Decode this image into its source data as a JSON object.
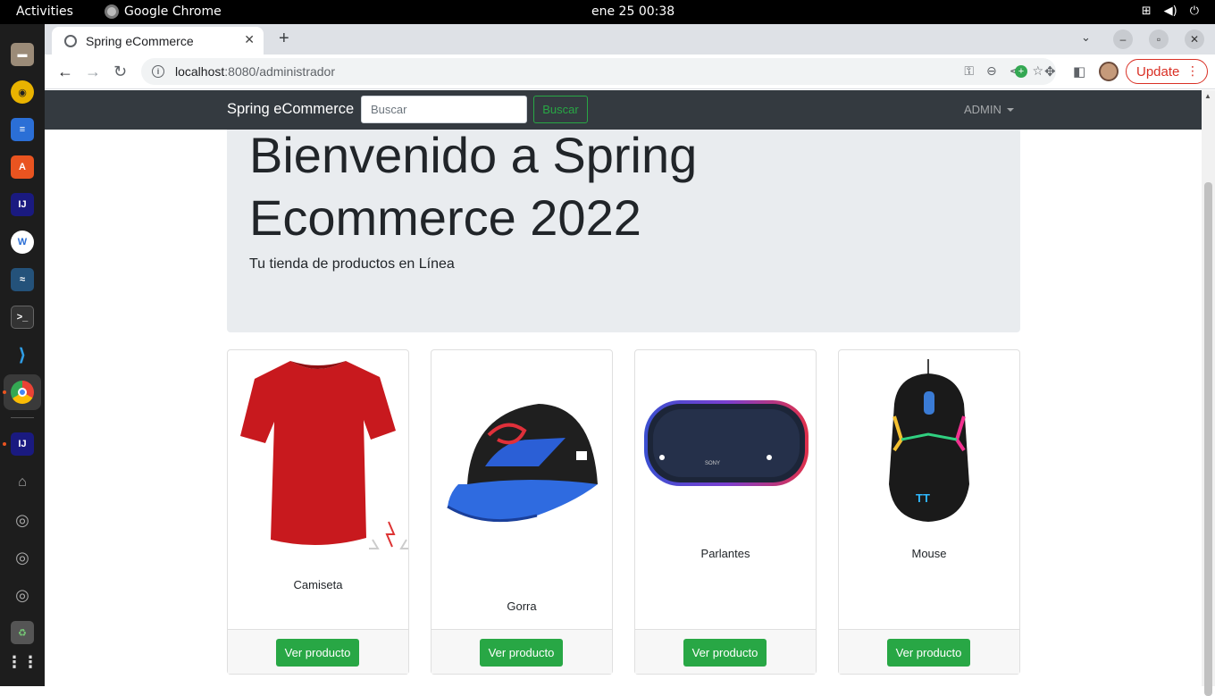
{
  "system": {
    "activities": "Activities",
    "app_name": "Google Chrome",
    "clock": "ene 25  00:38"
  },
  "browser": {
    "tab_title": "Spring eCommerce",
    "url_host": "localhost",
    "url_path": ":8080/administrador",
    "update_label": "Update"
  },
  "site": {
    "brand": "Spring eCommerce",
    "search_placeholder": "Buscar",
    "search_button": "Buscar",
    "admin_menu": "ADMIN",
    "accent_color": "#28a745",
    "navbar_color": "#343a40"
  },
  "hero": {
    "title": "Bienvenido a Spring Ecommerce 2022",
    "subtitle": "Tu tienda de productos en Línea"
  },
  "products": [
    {
      "name": "Camiseta",
      "image": "red-tshirt",
      "button": "Ver producto"
    },
    {
      "name": "Gorra",
      "image": "baseball-cap",
      "button": "Ver producto"
    },
    {
      "name": "Parlantes",
      "image": "bluetooth-speaker",
      "button": "Ver producto"
    },
    {
      "name": "Mouse",
      "image": "gaming-mouse",
      "button": "Ver producto"
    }
  ]
}
